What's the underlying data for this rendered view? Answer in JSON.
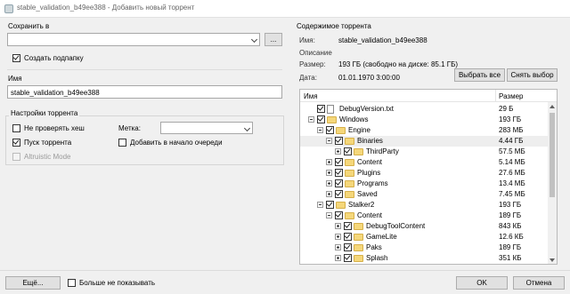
{
  "window": {
    "title": "stable_validation_b49ee388 - Добавить новый торрент",
    "icon": "app-icon"
  },
  "save_in": {
    "group_title": "Сохранить в",
    "path_value": "",
    "browse_label": "...",
    "create_subfolder_label": "Создать подпапку",
    "create_subfolder_checked": true
  },
  "name": {
    "group_title": "Имя",
    "value": "stable_validation_b49ee388"
  },
  "settings": {
    "group_title": "Настройки торрента",
    "skip_hash_label": "Не проверять хеш",
    "skip_hash_checked": false,
    "start_torrent_label": "Пуск торрента",
    "start_torrent_checked": true,
    "altruistic_label": "Altruistic Mode",
    "altruistic_checked": false,
    "label_caption": "Метка:",
    "label_value": "",
    "add_to_top_label": "Добавить в начало очереди",
    "add_to_top_checked": false
  },
  "contents": {
    "group_title": "Содержимое торрента",
    "name_label": "Имя:",
    "name_value": "stable_validation_b49ee388",
    "description_label": "Описание",
    "size_label": "Размер:",
    "size_value": "193 ГБ (свободно на диске: 85.1 ГБ)",
    "date_label": "Дата:",
    "date_value": "01.01.1970 3:00:00",
    "select_all_label": "Выбрать все",
    "deselect_label": "Снять выбор",
    "col_name": "Имя",
    "col_size": "Размер",
    "rows": [
      {
        "name": "DebugVersion.txt",
        "size": "29 Б",
        "type": "file"
      },
      {
        "name": "Windows",
        "size": "193 ГБ",
        "type": "folder"
      },
      {
        "name": "Engine",
        "size": "283 МБ",
        "type": "folder"
      },
      {
        "name": "Binaries",
        "size": "4.44 ГБ",
        "type": "folder"
      },
      {
        "name": "ThirdParty",
        "size": "57.5 МБ",
        "type": "folder"
      },
      {
        "name": "Content",
        "size": "5.14 МБ",
        "type": "folder"
      },
      {
        "name": "Plugins",
        "size": "27.6 МБ",
        "type": "folder"
      },
      {
        "name": "Programs",
        "size": "13.4 МБ",
        "type": "folder"
      },
      {
        "name": "Saved",
        "size": "7.45 МБ",
        "type": "folder"
      },
      {
        "name": "Stalker2",
        "size": "193 ГБ",
        "type": "folder"
      },
      {
        "name": "Content",
        "size": "189 ГБ",
        "type": "folder"
      },
      {
        "name": "DebugToolContent",
        "size": "843 КБ",
        "type": "folder"
      },
      {
        "name": "GameLite",
        "size": "12.6 КБ",
        "type": "folder"
      },
      {
        "name": "Paks",
        "size": "189 ГБ",
        "type": "folder"
      },
      {
        "name": "Splash",
        "size": "351 КБ",
        "type": "folder"
      }
    ]
  },
  "footer": {
    "more_label": "Ещё...",
    "dont_show_label": "Больше не показывать",
    "dont_show_checked": false,
    "ok_label": "OK",
    "cancel_label": "Отмена"
  }
}
